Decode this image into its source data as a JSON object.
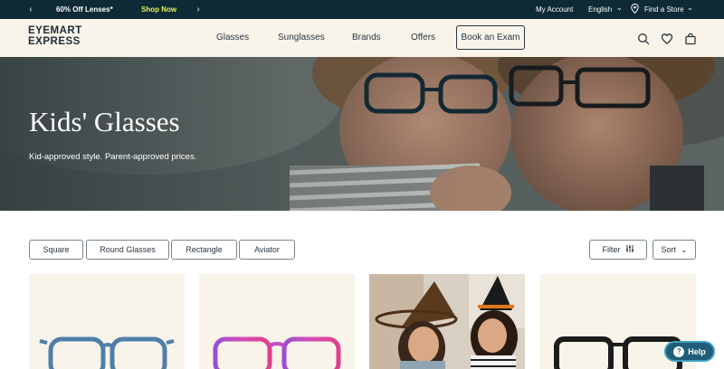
{
  "topbar": {
    "promo": "60% Off Lenses*",
    "shop_now": "Shop Now",
    "my_account": "My Account",
    "language": "English",
    "find_store": "Find a Store"
  },
  "header": {
    "logo_line1": "EYEMART",
    "logo_line2": "EXPRESS",
    "nav": [
      "Glasses",
      "Sunglasses",
      "Brands",
      "Offers"
    ],
    "book_exam": "Book an Exam"
  },
  "hero": {
    "title": "Kids' Glasses",
    "subtitle": "Kid-approved style. Parent-approved prices."
  },
  "filters": {
    "chips": [
      "Square",
      "Round Glasses",
      "Rectangle",
      "Aviator"
    ],
    "filter_label": "Filter",
    "sort_label": "Sort"
  },
  "products": [
    {
      "frame": "blue frames",
      "color": "#4f7fa8"
    },
    {
      "frame": "purple-pink frames",
      "color": "#b04ec0"
    },
    {
      "frame": "lifestyle photo"
    },
    {
      "frame": "black frames",
      "color": "#1c1c1c"
    }
  ],
  "help": {
    "label": "Help"
  },
  "colors": {
    "topbar": "#0e2a36",
    "accent": "#e5f05a",
    "header_bg": "#f8f4ea",
    "help": "#1f5d78"
  }
}
